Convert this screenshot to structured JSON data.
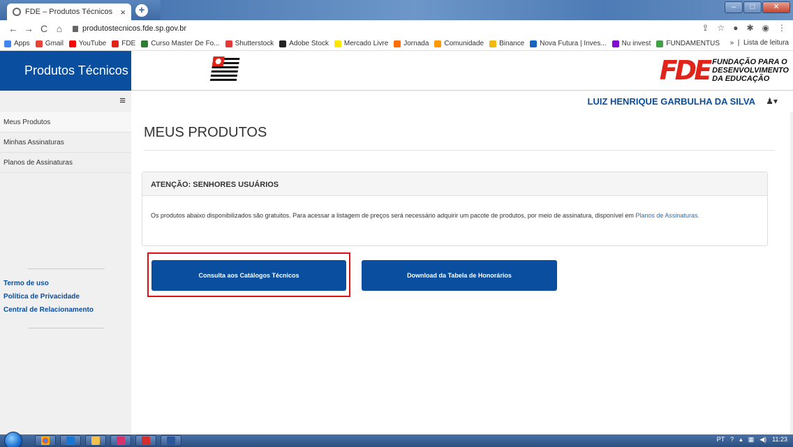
{
  "browser": {
    "tab_title": "FDE – Produtos Técnicos",
    "tab_close": "×",
    "new_tab": "+",
    "url": "produtostecnicos.fde.sp.gov.br"
  },
  "bookmarks": {
    "items": [
      {
        "label": "Apps",
        "color": "#4285f4"
      },
      {
        "label": "Gmail",
        "color": "#ea4335"
      },
      {
        "label": "YouTube",
        "color": "#ff0000"
      },
      {
        "label": "FDE",
        "color": "#e2231a"
      },
      {
        "label": "Curso Master De Fo...",
        "color": "#2e7d32"
      },
      {
        "label": "Shutterstock",
        "color": "#e53935"
      },
      {
        "label": "Adobe Stock",
        "color": "#222222"
      },
      {
        "label": "Mercado Livre",
        "color": "#ffe600"
      },
      {
        "label": "Jornada",
        "color": "#ff6d00"
      },
      {
        "label": "Comunidade",
        "color": "#ff9800"
      },
      {
        "label": "Binance",
        "color": "#f0b90b"
      },
      {
        "label": "Nova Futura | Inves...",
        "color": "#1565c0"
      },
      {
        "label": "Nu invest",
        "color": "#820ad1"
      },
      {
        "label": "FUNDAMENTUS",
        "color": "#43a047"
      }
    ],
    "more": "»",
    "reading_list": "Lista de leitura"
  },
  "header": {
    "brand": "Produtos Técnicos",
    "logo_mark": "FDE",
    "logo_line1": "FUNDAÇÃO PARA O",
    "logo_line2": "DESENVOLVIMENTO",
    "logo_line3": "DA EDUCAÇÃO"
  },
  "topbar": {
    "menu_icon": "≡",
    "username": "LUIZ HENRIQUE GARBULHA DA SILVA",
    "user_icon": "♟▾"
  },
  "sidebar": {
    "items": [
      {
        "label": "Meus Produtos"
      },
      {
        "label": "Minhas Assinaturas"
      },
      {
        "label": "Planos de Assinaturas"
      }
    ],
    "links": [
      {
        "label": "Termo de uso"
      },
      {
        "label": "Política de Privacidade"
      },
      {
        "label": "Central de Relacionamento"
      }
    ]
  },
  "main": {
    "title": "MEUS PRODUTOS",
    "alert_title": "ATENÇÃO: SENHORES USUÁRIOS",
    "alert_text": "Os produtos abaixo disponibilizados são gratuitos. Para acessar a listagem de preços será necessário adquirir um pacote de produtos, por meio de assinatura, disponível em ",
    "alert_link": "Planos de Assinaturas.",
    "btn_catalogos": "Consulta aos Catálogos Técnicos",
    "btn_tabela": "Download da Tabela de Honorários"
  },
  "taskbar": {
    "lang": "PT",
    "time": "11:23"
  }
}
